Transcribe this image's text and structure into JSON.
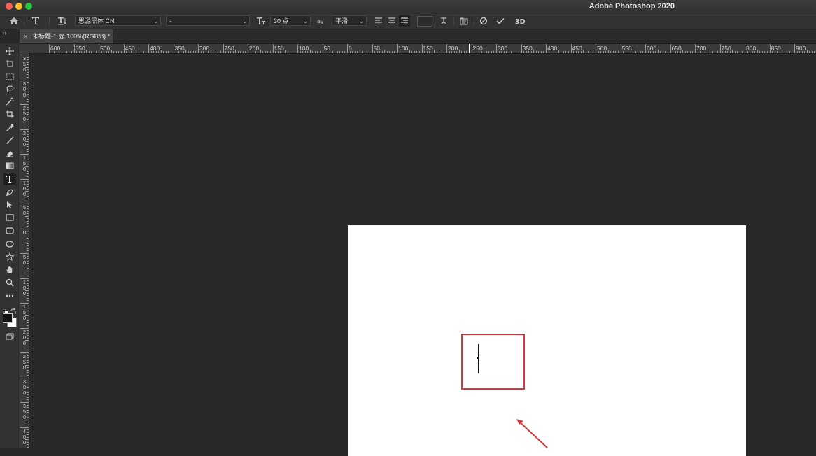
{
  "window": {
    "title": "Adobe Photoshop 2020"
  },
  "options_bar": {
    "font_family": "思源黑体 CN",
    "font_style": "-",
    "font_size": "30 点",
    "antialias": "平滑",
    "icons": [
      "home-icon",
      "type-tool-icon",
      "text-orientation-icon",
      "font-size-icon",
      "antialias-icon",
      "align-left-icon",
      "align-center-icon",
      "align-right-icon",
      "text-color-swatch",
      "warp-text-icon",
      "character-panel-icon",
      "cancel-icon",
      "commit-icon",
      "3d-icon"
    ]
  },
  "tab": {
    "close": "×",
    "title": "未标题-1 @ 100%(RGB/8) *"
  },
  "panel_toggle": "››",
  "ruler_top": [
    "600",
    "550",
    "500",
    "450",
    "400",
    "350",
    "300",
    "250",
    "200",
    "150",
    "100",
    "50",
    "0",
    "50",
    "100",
    "150",
    "200",
    "250",
    "300",
    "350",
    "400",
    "450",
    "500",
    "550",
    "600",
    "650",
    "700",
    "750",
    "800",
    "850",
    "900"
  ],
  "ruler_left": [
    "3\n5\n0",
    "3\n0\n0",
    "2\n5\n0",
    "2\n0\n0",
    "1\n5\n0",
    "1\n0\n0",
    "5\n0",
    "0",
    "5\n0",
    "1\n0\n0",
    "1\n5\n0",
    "2\n0\n0",
    "2\n5\n0",
    "3\n0\n0",
    "3\n5\n0",
    "4\n0\n0"
  ],
  "tools": [
    "move-tool-icon",
    "artboard-tool-icon",
    "marquee-tool-icon",
    "lasso-tool-icon",
    "magic-wand-icon",
    "crop-tool-icon",
    "eyedropper-icon",
    "brush-tool-icon",
    "eraser-tool-icon",
    "gradient-tool-icon",
    "type-tool-icon",
    "pen-tool-icon",
    "path-selection-icon",
    "rectangle-tool-icon",
    "rounded-rect-icon",
    "ellipse-tool-icon",
    "custom-shape-icon",
    "hand-tool-icon",
    "zoom-tool-icon",
    "more-tools-icon"
  ],
  "colors": {
    "accent_red": "#d6353a",
    "canvas_bg": "#282828",
    "document": "#ffffff"
  }
}
